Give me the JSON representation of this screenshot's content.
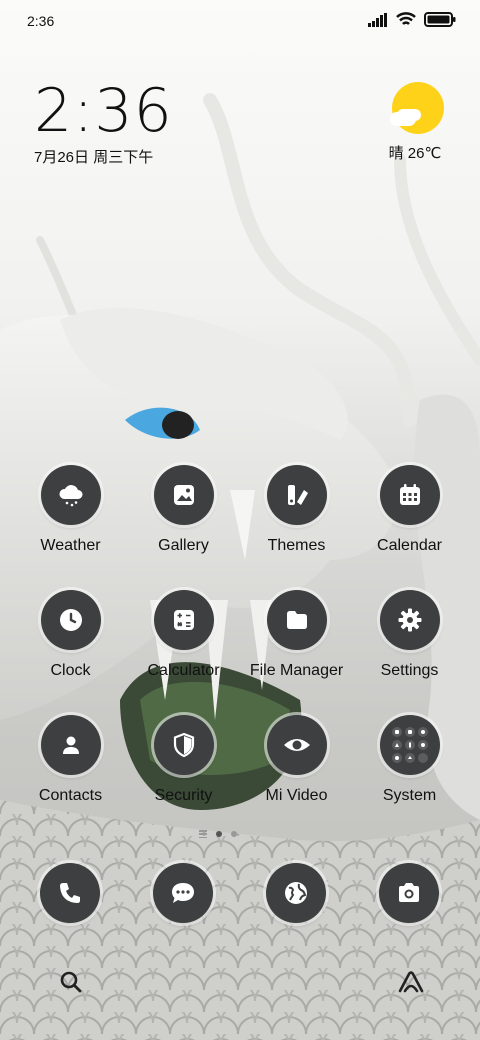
{
  "status_bar": {
    "time": "2:36"
  },
  "clock_widget": {
    "time": "2:36",
    "date": "7月26日 周三下午"
  },
  "weather_widget": {
    "text": "晴 26℃",
    "icon": "sunny-cloud-icon",
    "sun_color": "#ffd21a"
  },
  "apps": [
    {
      "label": "Weather",
      "icon": "weather-cloud-icon"
    },
    {
      "label": "Gallery",
      "icon": "gallery-icon"
    },
    {
      "label": "Themes",
      "icon": "themes-icon"
    },
    {
      "label": "Calendar",
      "icon": "calendar-icon"
    },
    {
      "label": "Clock",
      "icon": "clock-icon"
    },
    {
      "label": "Calculator",
      "icon": "calculator-icon"
    },
    {
      "label": "File Manager",
      "icon": "folder-icon"
    },
    {
      "label": "Settings",
      "icon": "gear-icon"
    },
    {
      "label": "Contacts",
      "icon": "contacts-icon"
    },
    {
      "label": "Security",
      "icon": "shield-icon"
    },
    {
      "label": "Mi Video",
      "icon": "eye-icon"
    },
    {
      "label": "System",
      "icon": "app-folder-icon"
    }
  ],
  "dock": [
    {
      "icon": "phone-icon"
    },
    {
      "icon": "message-icon"
    },
    {
      "icon": "browser-globe-icon"
    },
    {
      "icon": "camera-icon"
    }
  ],
  "bottom_bar": {
    "left_icon": "search-icon",
    "right_icon": "assistant-icon"
  },
  "colors": {
    "tile": "#3d3f40",
    "text": "#111111"
  }
}
